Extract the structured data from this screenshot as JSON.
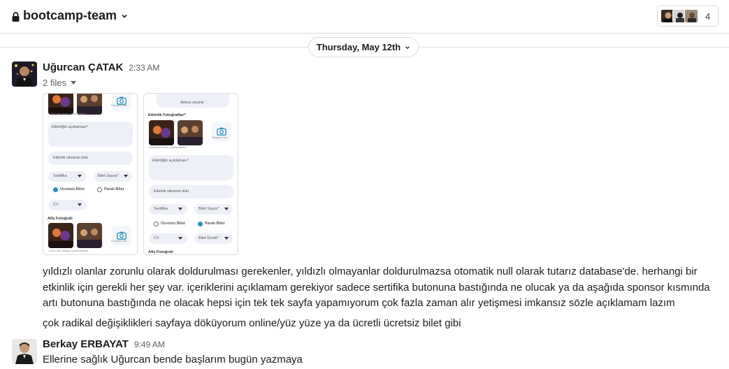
{
  "header": {
    "channel_name": "bootcamp-team",
    "member_count": "4"
  },
  "date_divider": {
    "label": "Thursday, May 12th"
  },
  "messages": [
    {
      "author": "Uğurcan ÇATAK",
      "time": "2:33 AM",
      "files_label": "2 files",
      "files": [
        {
          "photos_caption": "4 fotoğrafa kadar yükleyebilirsin",
          "description_placeholder": "Etkinliğin açıklaması*",
          "site_placeholder": "Etkinlik sitesinin linki",
          "certificate": "Sertifika",
          "ticket_count": "Bilet Sayısı*",
          "free_ticket": "Ücretsiz Bilet",
          "paid_ticket": "Paralı Bilet",
          "cv": "CV",
          "poster_title": "Afiş Fotoğrafı",
          "poster_caption": "1 adet afiş fotoğrafı yükleyebilirsin",
          "add_photo": "Fotoğraf Ekle"
        },
        {
          "address_placeholder": "Adresi seçiniz",
          "photos_title": "Etkinlik Fotoğrafları*",
          "photos_caption": "4 fotoğrafa kadar yükleyebilirsin",
          "description_placeholder": "Etkinliğin açıklaması*",
          "site_placeholder": "Etkinlik sitesinin linki",
          "certificate": "Sertifika",
          "ticket_count": "Bilet Sayısı*",
          "free_ticket": "Ücretsiz Bilet",
          "paid_ticket": "Paralı Bilet",
          "cv": "CV",
          "ticket_price": "Bilet Ücreti*",
          "poster_title": "Afiş Fotoğrafı",
          "add_photo": "Fotoğraf Ekle"
        }
      ],
      "paragraphs": [
        "yıldızlı olanlar zorunlu olarak doldurulması gerekenler, yıldızlı olmayanlar doldurulmazsa otomatik null olarak tutarız database'de. herhangi bir etkinlik için gerekli her şey var. içeriklerini açıklamam gerekiyor sadece sertifika butonuna bastığında ne olucak ya da aşağıda sponsor kısmında artı butonuna bastığında ne olacak hepsi için tek tek sayfa yapamıyorum çok fazla zaman alır yetişmesi imkansız sözle açıklamam lazım",
        "çok radikal değişiklikleri sayfaya döküyorum online/yüz yüze ya da ücretli ücretsiz bilet gibi"
      ]
    },
    {
      "author": "Berkay ERBAYAT",
      "time": "9:49 AM",
      "text": "Ellerine sağlık Uğurcan bende başlarım bugün yazmaya"
    }
  ]
}
